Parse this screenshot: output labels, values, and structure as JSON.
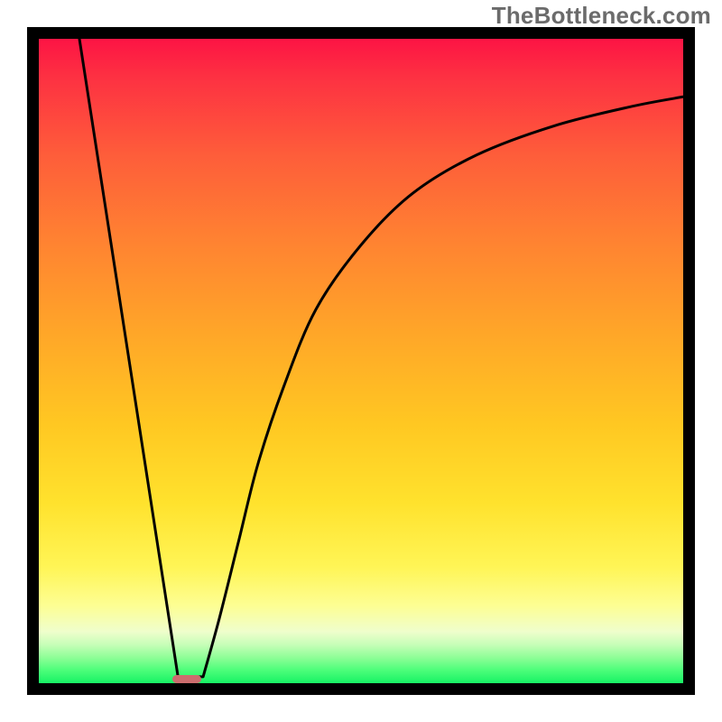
{
  "watermark": "TheBottleneck.com",
  "colors": {
    "frame": "#000000",
    "curve": "#000000",
    "marker": "#cc6d6e"
  },
  "chart_data": {
    "type": "line",
    "title": "",
    "xlabel": "",
    "ylabel": "",
    "xlim": [
      0,
      100
    ],
    "ylim": [
      0,
      100
    ],
    "grid": false,
    "annotations": [
      "TheBottleneck.com"
    ],
    "curve_left": {
      "comment": "Descending straight segment from top-left down to the notch",
      "x": [
        6.3,
        21.6
      ],
      "y": [
        100,
        1.0
      ]
    },
    "curve_right": {
      "comment": "Ascending diminishing-slope segment from notch toward top-right; values read off the background gradient color bands.",
      "x": [
        25.5,
        28,
        31,
        34,
        38,
        43,
        50,
        58,
        68,
        80,
        92,
        100
      ],
      "y": [
        1.0,
        10,
        22,
        34,
        46,
        58,
        68,
        76,
        82,
        86.5,
        89.5,
        91
      ]
    },
    "marker": {
      "comment": "Small rounded bar at the valley bottom",
      "x_center": 23.0,
      "width": 4.5,
      "y": 0.6,
      "height": 1.3
    },
    "gradient": {
      "comment": "Vertical background gradient acting as the y-axis color scale",
      "stops": [
        {
          "pos": 0.0,
          "color": "#fd1444"
        },
        {
          "pos": 0.06,
          "color": "#fd3142"
        },
        {
          "pos": 0.18,
          "color": "#fe5d3a"
        },
        {
          "pos": 0.32,
          "color": "#ff8431"
        },
        {
          "pos": 0.46,
          "color": "#ffa728"
        },
        {
          "pos": 0.6,
          "color": "#ffc822"
        },
        {
          "pos": 0.72,
          "color": "#ffe22d"
        },
        {
          "pos": 0.82,
          "color": "#fff556"
        },
        {
          "pos": 0.88,
          "color": "#fdfe94"
        },
        {
          "pos": 0.92,
          "color": "#effecc"
        },
        {
          "pos": 0.94,
          "color": "#c7feb8"
        },
        {
          "pos": 0.96,
          "color": "#8ffe97"
        },
        {
          "pos": 0.98,
          "color": "#4cfe7a"
        },
        {
          "pos": 1.0,
          "color": "#17f264"
        }
      ]
    }
  }
}
